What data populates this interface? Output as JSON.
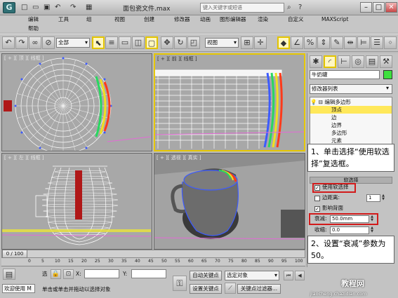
{
  "window": {
    "title": "面包瓷文件.max",
    "search_placeholder": "键入关键字或短语"
  },
  "titlebar": {
    "logo": "G"
  },
  "menu": [
    "编辑",
    "工具",
    "组",
    "视图",
    "创建",
    "修改器",
    "动画",
    "图形编辑器",
    "渲染",
    "自定义",
    "MAXScript",
    "帮助"
  ],
  "toolbar": {
    "selection_filter": "全部",
    "view_mode": "视图"
  },
  "viewports": {
    "top": "[ + ][ 顶 ][ 线框 ]",
    "front": "[ + ][ 前 ][ 线框 ]",
    "left": "[ + ][ 左 ][ 线框 ]",
    "perspective": "[ + ][ 透视 ][ 真实 ]"
  },
  "panel": {
    "object_name": "牛奶罐",
    "modifier_list": "修改器列表",
    "stack": {
      "root": "编辑多边形",
      "items": [
        "顶点",
        "边",
        "边界",
        "多边形",
        "元素"
      ]
    },
    "rollout_selection": "选择",
    "rollout_soft": "软选择",
    "use_soft": "使用软选择",
    "edge_distance_label": "边距离:",
    "edge_distance_value": "1",
    "affect_backfacing": "影响背面",
    "falloff_label": "衰减:",
    "falloff_value": "50.0mm",
    "pinch_label": "收缩:",
    "pinch_value": "0.0"
  },
  "callouts": {
    "step1": "1、单击选择“使用软选择”复选框。",
    "step2": "2、设置“衰减”参数为 50。"
  },
  "timeline": {
    "frame": "0 / 100",
    "ticks": [
      "0",
      "5",
      "10",
      "15",
      "20",
      "25",
      "30",
      "35",
      "40",
      "45",
      "50",
      "55",
      "60",
      "65",
      "70",
      "75",
      "80",
      "85",
      "90",
      "95",
      "100"
    ]
  },
  "status": {
    "welcome": "欢迎使用 M",
    "prompt": "单击或单击并拖动以选择对象",
    "sel_label": "选",
    "x_label": "X:",
    "y_label": "Y:",
    "auto_key": "自动关键点",
    "set_key": "设置关键点",
    "selected_object": "选定对象",
    "key_filters": "关键点过滤器..."
  },
  "watermark": {
    "text": "jiaocheng.chazidian.com",
    "brand": "教程网"
  }
}
